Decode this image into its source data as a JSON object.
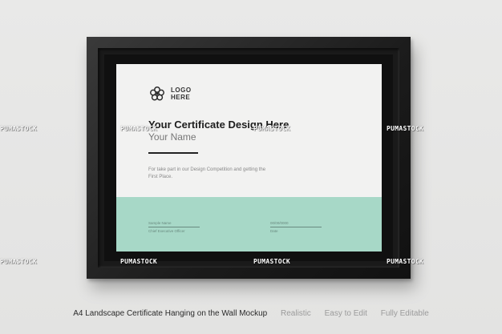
{
  "certificate": {
    "logo_text": "LOGO HERE",
    "title": "Your Certificate Design Here",
    "name": "Your Name",
    "description": "For take part in our Design Competition and getting the First Place.",
    "signature_left_name": "Sample Name",
    "signature_left_role": "Chief Executive Officer",
    "signature_right_date": "00/00/0000",
    "signature_right_role": "Date"
  },
  "watermark": {
    "text": "PUMASTOCK"
  },
  "caption": {
    "title": "A4 Landscape Certificate Hanging on the Wall Mockup",
    "tags": [
      "Realistic",
      "Easy to Edit",
      "Fully Editable"
    ]
  },
  "colors": {
    "band": "#a7d8c7",
    "frame": "#1b1b1b",
    "wall": "#e6e6e5",
    "paper": "#f2f2f1"
  },
  "icons": {
    "logo": "flower-icon"
  }
}
